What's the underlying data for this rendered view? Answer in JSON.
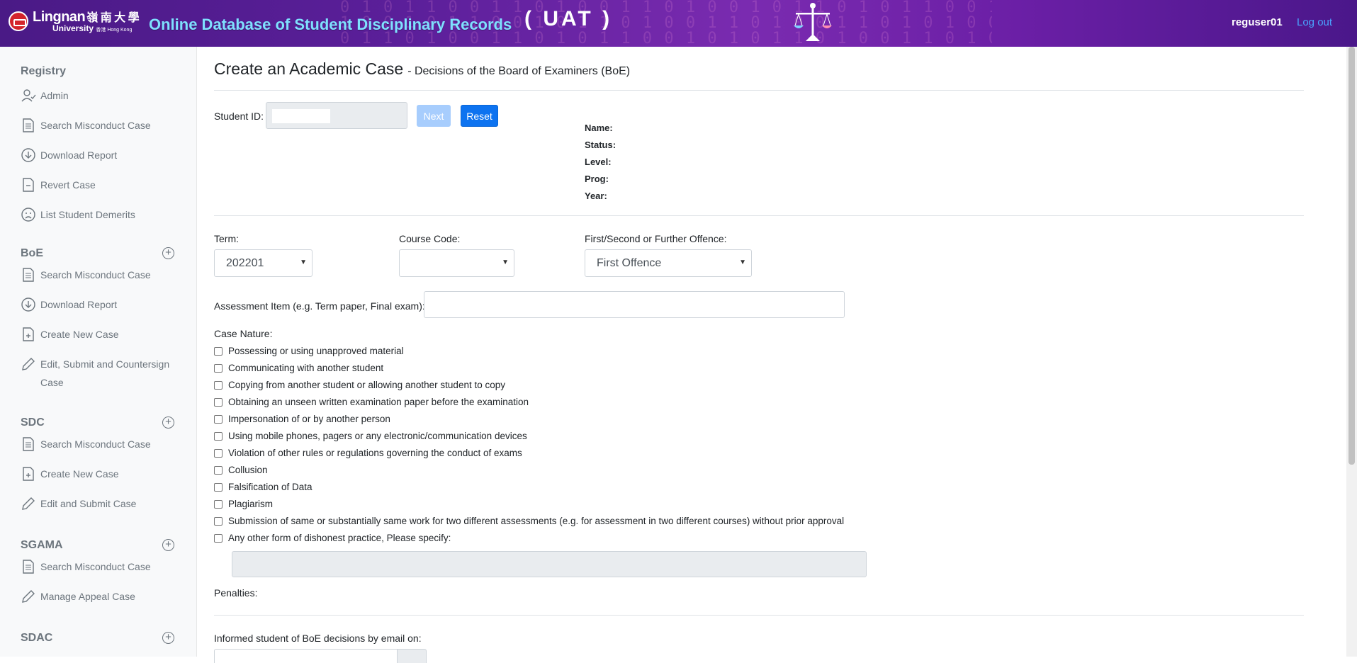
{
  "header": {
    "logo_en": "Lingnan",
    "logo_cn": "嶺 南 大 學",
    "logo_en2": "University",
    "logo_cn2": "香港 Hong Kong",
    "app_title": "Online Database of Student Disciplinary Records",
    "env_tag": "( UAT )",
    "username": "reguser01",
    "logout_label": "Log out",
    "scales_icon": "scales-of-justice-icon"
  },
  "sidebar": {
    "sections": [
      {
        "title": "Registry",
        "items": [
          {
            "label": "Admin",
            "icon": "user-check-icon"
          },
          {
            "label": "Search Misconduct Case",
            "icon": "document-icon"
          },
          {
            "label": "Download Report",
            "icon": "download-circle-icon"
          },
          {
            "label": "Revert Case",
            "icon": "document-minus-icon"
          },
          {
            "label": "List Student Demerits",
            "icon": "sad-face-icon"
          }
        ]
      },
      {
        "title": "BoE",
        "items": [
          {
            "label": "Search Misconduct Case",
            "icon": "document-icon"
          },
          {
            "label": "Download Report",
            "icon": "download-circle-icon"
          },
          {
            "label": "Create New Case",
            "icon": "document-plus-icon"
          },
          {
            "label": "Edit, Submit and Countersign Case",
            "icon": "pencil-icon"
          }
        ]
      },
      {
        "title": "SDC",
        "items": [
          {
            "label": "Search Misconduct Case",
            "icon": "document-icon"
          },
          {
            "label": "Create New Case",
            "icon": "document-plus-icon"
          },
          {
            "label": "Edit and Submit Case",
            "icon": "pencil-icon"
          }
        ]
      },
      {
        "title": "SGAMA",
        "items": [
          {
            "label": "Search Misconduct Case",
            "icon": "document-icon"
          },
          {
            "label": "Manage Appeal Case",
            "icon": "pencil-icon"
          }
        ]
      },
      {
        "title": "SDAC",
        "items": []
      }
    ]
  },
  "main": {
    "title": "Create an Academic Case",
    "subtitle": "- Decisions of the Board of Examiners (BoE)",
    "student_id_label": "Student ID:",
    "student_id_value": "",
    "next_label": "Next",
    "reset_label": "Reset",
    "info_labels": [
      "Name:",
      "Status:",
      "Level:",
      "Prog:",
      "Year:"
    ],
    "term_label": "Term:",
    "term_value": "202201",
    "course_label": "Course Code:",
    "course_value": "",
    "offence_label": "First/Second or Further Offence:",
    "offence_value": "First Offence",
    "assessment_label": "Assessment Item (e.g. Term paper, Final exam):",
    "assessment_value": "",
    "case_nature_label": "Case Nature:",
    "case_natures": [
      "Possessing or using unapproved material",
      "Communicating with another student",
      "Copying from another student or allowing another student to copy",
      "Obtaining an unseen written examination paper before the examination",
      "Impersonation of or by another person",
      "Using mobile phones, pagers or any electronic/communication devices",
      "Violation of other rules or regulations governing the conduct of exams",
      "Collusion",
      "Falsification of Data",
      "Plagiarism",
      "Submission of same or substantially same work for two different assessments (e.g. for assessment in two different courses) without prior approval",
      "Any other form of dishonest practice, Please specify:"
    ],
    "penalties_label": "Penalties:",
    "informed_label": "Informed student of BoE decisions by email on:"
  }
}
